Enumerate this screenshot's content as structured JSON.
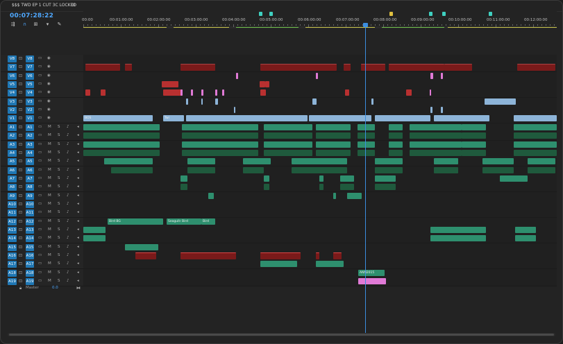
{
  "panel": {
    "title": "$$$ TWD EP 1 CUT 3C LOCKED",
    "menu_icon": "hamburger-icon",
    "timecode": "00:07:28:22"
  },
  "tools": [
    "insert-icon",
    "snap-icon",
    "linked-selection-icon",
    "add-marker-icon",
    "settings-icon"
  ],
  "ruler": {
    "labels": [
      "00:00",
      "00:01:00:00",
      "00:02:00:00",
      "00:03:00:00",
      "00:04:00:00",
      "00:05:00:00",
      "00:06:00:00",
      "00:07:00:00",
      "00:08:00:00",
      "00:09:00:00",
      "00:10:00:00",
      "00:11:00:00",
      "00:12:00:00"
    ]
  },
  "video_tracks": [
    {
      "src": "V8",
      "name": "V8"
    },
    {
      "src": "V7",
      "name": "V7"
    },
    {
      "src": "V6",
      "name": "V6"
    },
    {
      "src": "V5",
      "name": "V5"
    },
    {
      "src": "V4",
      "name": "V4"
    },
    {
      "src": "V3",
      "name": "V3"
    },
    {
      "src": "V2",
      "name": "V2"
    },
    {
      "src": "V1",
      "name": "V1"
    }
  ],
  "audio_tracks": [
    {
      "src": "A1",
      "name": "A1"
    },
    {
      "src": "A2",
      "name": "A2"
    },
    {
      "src": "A3",
      "name": "A3"
    },
    {
      "src": "A4",
      "name": "A4"
    },
    {
      "src": "A5",
      "name": "A5"
    },
    {
      "src": "A6",
      "name": "A6"
    },
    {
      "src": "A7",
      "name": "A7"
    },
    {
      "src": "A8",
      "name": "A8"
    },
    {
      "src": "A9",
      "name": "A9"
    },
    {
      "src": "A10",
      "name": "A10"
    },
    {
      "src": "A11",
      "name": "A11"
    },
    {
      "src": "A12",
      "name": "A12"
    },
    {
      "src": "A13",
      "name": "A13"
    },
    {
      "src": "A14",
      "name": "A14"
    },
    {
      "src": "A15",
      "name": "A15"
    },
    {
      "src": "A16",
      "name": "A16"
    },
    {
      "src": "A17",
      "name": "A17"
    },
    {
      "src": "A18",
      "name": "A18"
    },
    {
      "src": "A19",
      "name": "A19"
    }
  ],
  "audio_controls": {
    "mute": "M",
    "solo": "S"
  },
  "master": {
    "label": "Master",
    "value": "0.0"
  },
  "clip_labels": {
    "v1_a": "BOS",
    "v1_b": "Twi",
    "a13_a": "Bird BG",
    "a13_b": "Seagulls",
    "a13_c": "Bird",
    "a13_d": "Bird",
    "a19_a": "ANN2015"
  },
  "colors": {
    "accent": "#4fa8ff",
    "track_patch": "#1f77b4",
    "video_clip": "#8db4d8",
    "adjust_clip": "#7a1a1a",
    "audio_clip": "#2e8f6e",
    "audio_clip_dark": "#1f5a3d",
    "pink": "#e07ad6",
    "red": "#b83030"
  }
}
